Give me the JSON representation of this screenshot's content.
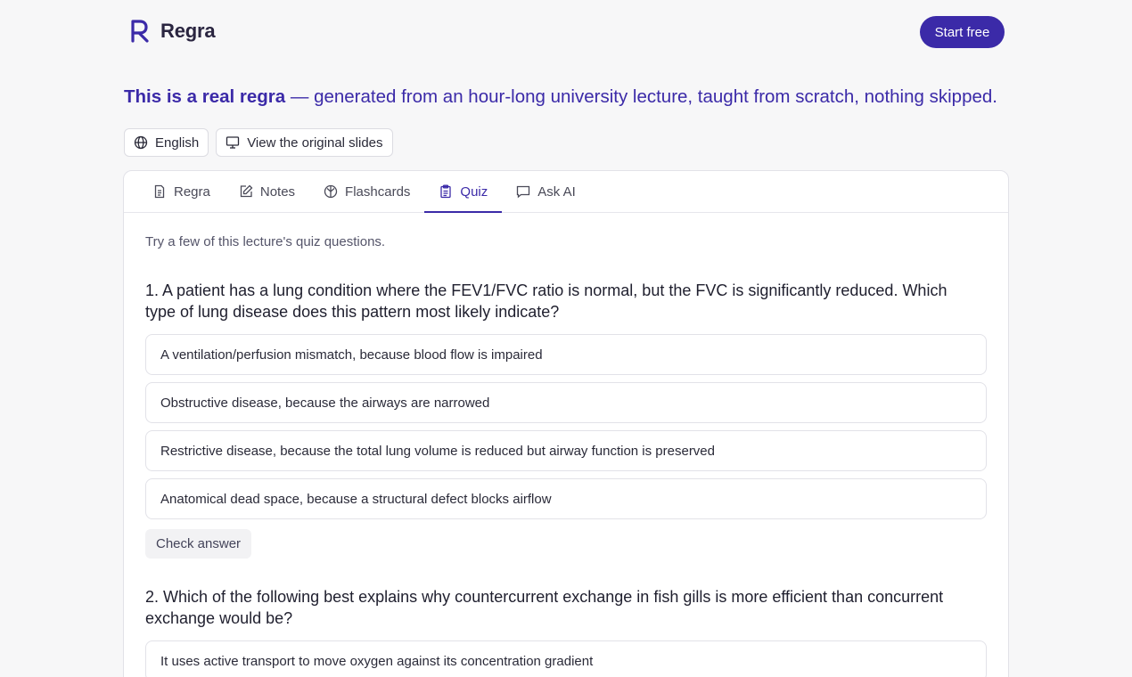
{
  "brand": {
    "name": "Regra",
    "accent": "#3b2aa8"
  },
  "header": {
    "cta_label": "Start free"
  },
  "hero": {
    "strong": "This is a real regra",
    "rest": " — generated from an hour-long university lecture, taught from scratch, nothing skipped."
  },
  "pills": [
    {
      "label": "English",
      "icon": "globe-icon"
    },
    {
      "label": "View the original slides",
      "icon": "presentation-icon"
    }
  ],
  "tabs": [
    {
      "label": "Regra",
      "icon": "document-icon",
      "active": false
    },
    {
      "label": "Notes",
      "icon": "edit-note-icon",
      "active": false
    },
    {
      "label": "Flashcards",
      "icon": "flashcards-icon",
      "active": false
    },
    {
      "label": "Quiz",
      "icon": "clipboard-icon",
      "active": true
    },
    {
      "label": "Ask AI",
      "icon": "chat-icon",
      "active": false
    }
  ],
  "quiz": {
    "intro": "Try a few of this lecture's quiz questions.",
    "check_label": "Check answer",
    "questions": [
      {
        "text": "1. A patient has a lung condition where the FEV1/FVC ratio is normal, but the FVC is significantly reduced. Which type of lung disease does this pattern most likely indicate?",
        "options": [
          "A ventilation/perfusion mismatch, because blood flow is impaired",
          "Obstructive disease, because the airways are narrowed",
          "Restrictive disease, because the total lung volume is reduced but airway function is preserved",
          "Anatomical dead space, because a structural defect blocks airflow"
        ]
      },
      {
        "text": "2. Which of the following best explains why countercurrent exchange in fish gills is more efficient than concurrent exchange would be?",
        "options": [
          "It uses active transport to move oxygen against its concentration gradient"
        ]
      }
    ]
  }
}
